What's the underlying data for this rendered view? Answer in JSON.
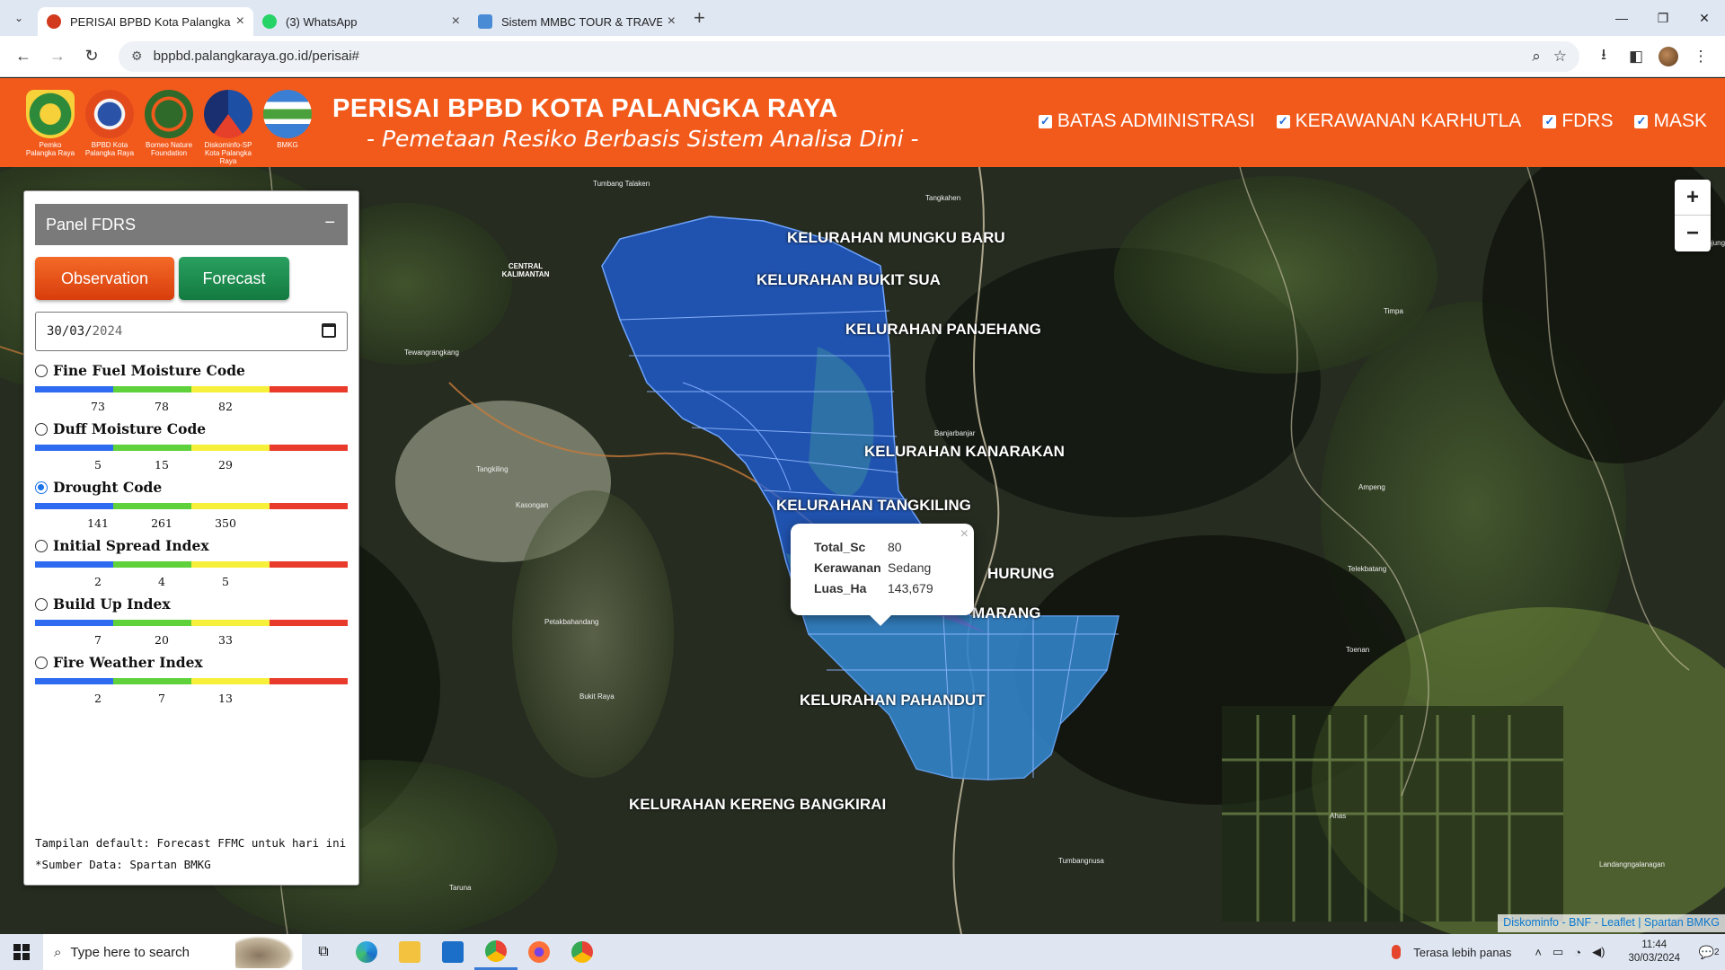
{
  "browser": {
    "tabs": [
      {
        "title": "PERISAI BPBD Kota Palangka Ra",
        "active": true,
        "favicon_color": "#d13a1d"
      },
      {
        "title": "(3) WhatsApp",
        "active": false,
        "favicon_color": "#25d366",
        "badge": "3"
      },
      {
        "title": "Sistem MMBC TOUR & TRAVEL",
        "active": false,
        "favicon_color": "#4a8bd6"
      }
    ],
    "url": "bppbd.palangkaraya.go.id/perisai#"
  },
  "header": {
    "title": "PERISAI BPBD KOTA PALANGKA RAYA",
    "subtitle": "- Pemetaan Resiko Berbasis Sistem Analisa Dini -",
    "logos": [
      {
        "caption": "Pemko Palangka Raya",
        "icon": "pemko-logo"
      },
      {
        "caption": "BPBD Kota Palangka Raya",
        "icon": "bpbd-logo"
      },
      {
        "caption": "Borneo Nature Foundation",
        "icon": "bnf-logo"
      },
      {
        "caption": "Diskominfo-SP Kota Palangka Raya",
        "icon": "diskominfo-logo"
      },
      {
        "caption": "BMKG",
        "icon": "bmkg-logo"
      }
    ],
    "layers": [
      {
        "label": "BATAS ADMINISTRASI",
        "checked": true
      },
      {
        "label": "KERAWANAN KARHUTLA",
        "checked": true
      },
      {
        "label": "FDRS",
        "checked": true
      },
      {
        "label": "MASK",
        "checked": true
      }
    ]
  },
  "panel": {
    "title": "Panel FDRS",
    "minimize": "−",
    "observation_label": "Observation",
    "forecast_label": "Forecast",
    "date": {
      "dd": "30",
      "mm": "03",
      "yyyy": "2024"
    },
    "scale_colors": [
      "#2e6bf0",
      "#5fd13b",
      "#f6f03a",
      "#e83b2b"
    ],
    "indices": [
      {
        "name": "Fine Fuel Moisture Code",
        "selected": false,
        "ticks": [
          "73",
          "78",
          "82"
        ]
      },
      {
        "name": "Duff Moisture Code",
        "selected": false,
        "ticks": [
          "5",
          "15",
          "29"
        ]
      },
      {
        "name": "Drought Code",
        "selected": true,
        "ticks": [
          "141",
          "261",
          "350"
        ]
      },
      {
        "name": "Initial Spread Index",
        "selected": false,
        "ticks": [
          "2",
          "4",
          "5"
        ]
      },
      {
        "name": "Build Up Index",
        "selected": false,
        "ticks": [
          "7",
          "20",
          "33"
        ]
      },
      {
        "name": "Fire Weather Index",
        "selected": false,
        "ticks": [
          "2",
          "7",
          "13"
        ]
      }
    ],
    "note1": "Tampilan default: Forecast FFMC untuk hari ini",
    "note2": "*Sumber Data: Spartan BMKG"
  },
  "map": {
    "kelurahan_labels": [
      "KELURAHAN MUNGKU BARU",
      "KELURAHAN BUKIT SUA",
      "KELURAHAN PANJEHANG",
      "KELURAHAN KANARAKAN",
      "KELURAHAN TANGKILING",
      "HURUNG",
      "MARANG",
      "KELURAHAN PAHANDUT",
      "KELURAHAN KERENG BANGKIRAI"
    ],
    "place_labels": [
      "Tumbang Talaken",
      "Tangkahen",
      "CENTRAL KALIMANTAN",
      "Timpa",
      "Tewangrangkang",
      "Banjarbanjar",
      "Tangkiling",
      "Ampeng",
      "Kasongan",
      "Telekbatang",
      "Petakbahandang",
      "Toenan",
      "Bukit Raya",
      "Ahas",
      "Tumbangnusa",
      "Landangngalanagan",
      "Taruna",
      "Tanjung"
    ],
    "zoom_in": "+",
    "zoom_out": "−",
    "popup": {
      "rows": [
        {
          "key": "Total_Sc",
          "value": "80"
        },
        {
          "key": "Kerawanan",
          "value": "Sedang"
        },
        {
          "key": "Luas_Ha",
          "value": "143,679"
        }
      ],
      "close": "×"
    },
    "attribution": "Diskominfo - BNF - Leaflet | Spartan BMKG"
  },
  "taskbar": {
    "search_placeholder": "Type here to search",
    "weather": "Terasa lebih panas",
    "time": "11:44",
    "date": "30/03/2024",
    "notifications": "2"
  }
}
